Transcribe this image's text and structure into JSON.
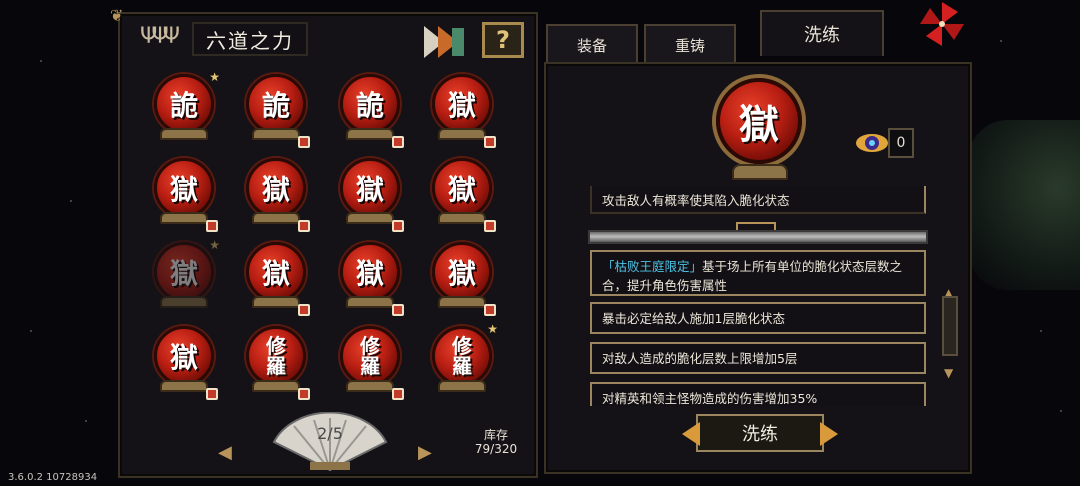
{
  "left_panel": {
    "title": "六道之力",
    "help_label": "?",
    "runes": [
      {
        "glyph": "詭",
        "star": true,
        "lock": false,
        "dim": false
      },
      {
        "glyph": "詭",
        "star": false,
        "lock": true,
        "dim": false
      },
      {
        "glyph": "詭",
        "star": false,
        "lock": true,
        "dim": false
      },
      {
        "glyph": "獄",
        "star": false,
        "lock": true,
        "dim": false
      },
      {
        "glyph": "獄",
        "star": false,
        "lock": true,
        "dim": false
      },
      {
        "glyph": "獄",
        "star": false,
        "lock": true,
        "dim": false
      },
      {
        "glyph": "獄",
        "star": false,
        "lock": true,
        "dim": false
      },
      {
        "glyph": "獄",
        "star": false,
        "lock": true,
        "dim": false
      },
      {
        "glyph": "獄",
        "star": true,
        "lock": false,
        "dim": true
      },
      {
        "glyph": "獄",
        "star": false,
        "lock": true,
        "dim": false
      },
      {
        "glyph": "獄",
        "star": false,
        "lock": true,
        "dim": false
      },
      {
        "glyph": "獄",
        "star": false,
        "lock": true,
        "dim": false
      },
      {
        "glyph": "獄",
        "star": false,
        "lock": true,
        "dim": false
      },
      {
        "glyph": "修羅",
        "star": false,
        "lock": true,
        "dim": false
      },
      {
        "glyph": "修羅",
        "star": false,
        "lock": true,
        "dim": false
      },
      {
        "glyph": "修羅",
        "star": true,
        "lock": false,
        "dim": false
      }
    ],
    "page": "2/5",
    "stock_label": "库存",
    "stock_value": "79/320",
    "nav_prev": "◀",
    "nav_next": "▶"
  },
  "tabs": [
    "装备",
    "重铸",
    "洗练"
  ],
  "right_panel": {
    "selected_glyph": "獄",
    "currency_count": "0",
    "lines": [
      "攻击敌人有概率使其陷入脆化状态",
      "「枯败王庭限定」基于场上所有单位的脆化状态层数之合，提升角色伤害属性",
      "暴击必定给敌人施加1层脆化状态",
      "对敌人造成的脆化层数上限增加5层",
      "对精英和领主怪物造成的伤害增加35%"
    ],
    "highlight_prefix": "「枯败王庭限定」",
    "reroll_label": "洗练"
  },
  "version": "3.6.0.2 10728934",
  "colors": {
    "orb_red": "#b81e12",
    "gold": "#b8945a",
    "highlight": "#4ec4e6"
  }
}
